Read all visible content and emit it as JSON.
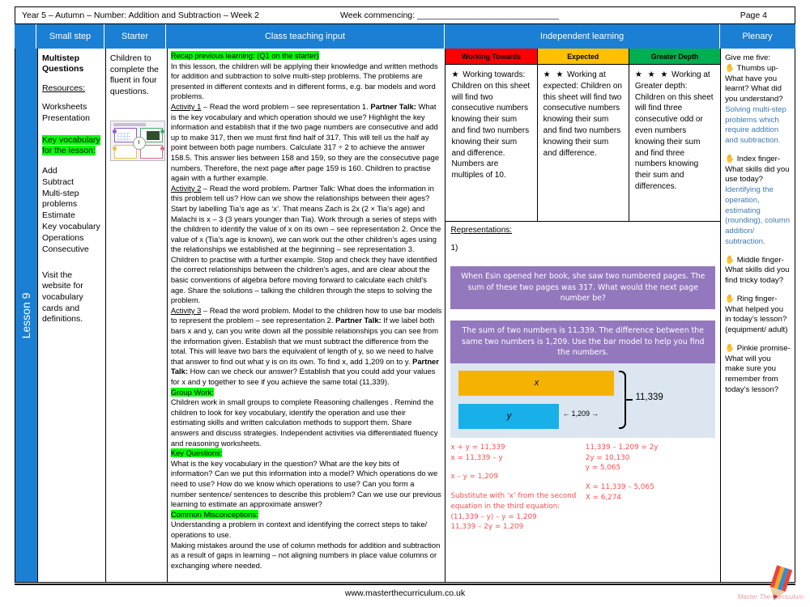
{
  "header": {
    "title": "Year 5 – Autumn – Number: Addition and Subtraction – Week 2",
    "week_commencing_label": "Week commencing: ______________________________",
    "page": "Page 4"
  },
  "columns": {
    "small_step": "Small step",
    "starter": "Starter",
    "class_teaching_input": "Class teaching input",
    "independent_learning": "Independent learning",
    "plenary": "Plenary"
  },
  "lesson_spine": "Lesson 9",
  "small_step": {
    "title": "Multistep Questions",
    "resources_label": "Resources:",
    "resources": [
      "Worksheets",
      "Presentation"
    ],
    "vocab_heading": "Key vocabulary for the lesson:",
    "vocab": [
      "Add",
      "Subtract",
      "Multi-step",
      "problems",
      "Estimate",
      "Key vocabulary",
      "Operations",
      "Consecutive"
    ],
    "visit_note": "Visit the website for vocabulary cards and definitions."
  },
  "starter": {
    "text": "Children to complete the fluent in four questions.",
    "thumbnail_name": "fluent-in-four-worksheet-thumbnail"
  },
  "class_input": {
    "recap_heading": "Recap previous learning: (Q1 on the starter)",
    "intro": "In this lesson, the children will be applying their knowledge and written methods for addition and subtraction to solve multi-step problems. The problems are presented in different contexts and in different forms, e.g. bar models and word problems.",
    "activity1_label": "Activity 1",
    "activity1_lead": " – Read the word problem – see representation 1. ",
    "activity1_talk": "Partner Talk:",
    "activity1_text": " What is the key vocabulary and which operation should we use? Highlight the key information and establish that if the two page numbers are consecutive and add up to make 317, then we must first find half of 317. This will tell us the half ay point between both page numbers. Calculate 317 ÷ 2 to achieve the answer 158.5. This answer lies between 158 and 159, so they are the consecutive page numbers. Therefore, the next page after page 159 is 160. Children to practise again with a further example.",
    "activity2_label": "Activity 2",
    "activity2_text": " – Read the word problem. Partner Talk: What does the information in this problem tell us? How can we show the relationships between their ages?  Start by labelling Tia’s age as ‘x’. That means Zach is 2x (2 × Tia’s age) and Malachi is x – 3 (3 years younger than Tia).  Work through a series of steps with the children to identify the value of x on its own – see representation 2. Once the value of x (Tia’s age is known), we can work out the other children’s ages using the relationships we established at the beginning – see representation 3. Children to practise with a further example. Stop and check they have identified the correct relationships between the children’s ages, and are clear about the basic conventions of algebra before moving forward to calculate each child’s age. Share the solutions – talking the children through the steps to solving the problem.",
    "activity3_label": "Activity 3",
    "activity3_lead": " – Read the word problem. Model to the children how to use bar models to represent the  problem – see representation 2. ",
    "activity3_talk1": "Partner Talk:",
    "activity3_text1": " If we label both bars x and y, can you write down all the possible relationships you can see from the information given. Establish that we must subtract the difference from the total.  This will leave two bars the equivalent of length of y, so we need to halve that answer to find out what y is on its own. To find x, add 1,209 on to y. ",
    "activity3_talk2": "Partner Talk:",
    "activity3_text2": " How can we check our answer? Establish that you could add your values for x and y together to see if you achieve the same total (11,339).",
    "group_work_heading": "Group Work:",
    "group_work_text": "Children work in small groups to complete Reasoning challenges . Remind the children to look for key vocabulary, identify the operation and use their estimating skills and written calculation methods to support them. Share answers and discuss strategies. Independent activities via differentiated fluency and reasoning worksheets.",
    "key_questions_heading": "Key Questions:",
    "key_questions_text": "What is the key vocabulary in the question? What are the key bits of information? Can we put this information into a model? Which operations do we need to use? How do we know which operations to use? Can you form a number sentence/ sentences to describe this problem? Can we use our previous learning to estimate an approximate answer?",
    "misconceptions_heading": "Common Misconceptions:",
    "misconceptions_text1": "Understanding a problem in context and identifying the correct steps to take/ operations to use.",
    "misconceptions_text2": "Making mistakes around the use of column methods for addition and subtraction as a result of gaps in learning – not aligning numbers in place value columns or exchanging where needed."
  },
  "independent": {
    "levels": [
      {
        "header": "Working Towards",
        "color": "#FF0000",
        "stars": "★",
        "lead": "Working towards:",
        "text": "Children on this sheet will find two consecutive numbers knowing their sum and find two numbers knowing their sum and difference. Numbers are multiples of 10."
      },
      {
        "header": "Expected",
        "color": "#FFC000",
        "stars": "★ ★",
        "lead": "Working at expected:",
        "text": "Children on this sheet will find two consecutive numbers knowing their sum and find two numbers knowing their sum and difference."
      },
      {
        "header": "Greater Depth",
        "color": "#00B050",
        "stars": "★ ★ ★",
        "lead": "Working at Greater depth:",
        "text": "Children on this sheet will find three consecutive odd or even numbers knowing their sum and find three numbers knowing their sum and differences."
      }
    ],
    "representations_label": "Representations:",
    "rep_number": "1)",
    "problem1": "When Esin opened her book, she saw two numbered pages. The sum of these two pages was 317. What would the next page number be?",
    "problem2": "The sum of two numbers is 11,339. The difference between the same two numbers is 1,209. Use the bar model to help you find the numbers.",
    "bar_model": {
      "bar_x_label": "x",
      "bar_y_label": "y",
      "total_label": "11,339",
      "difference_label": "1,209",
      "bar_x_color": "#F5B300",
      "bar_y_color": "#18B0E8",
      "background_color": "#DCE6F1"
    },
    "equations_left": [
      "x + y = 11,339",
      "x = 11,339 – y",
      "",
      "x – y = 1,209",
      "",
      "Substitute with ‘x’ from the second",
      "equation in the third equation:",
      "(11,339 – y) – y = 1,209",
      "11,339 – 2y = 1,209"
    ],
    "equations_right": [
      "11,339 – 1,209 = 2y",
      "2y = 10,130",
      "y = 5,065",
      "",
      "X = 11,339 – 5,065",
      "X = 6,274"
    ]
  },
  "plenary": {
    "intro": "Give me five:",
    "items": [
      {
        "q": "Thumbs up- What have you learnt? What did you understand?",
        "a": "Solving multi-step problems which require addition and subtraction."
      },
      {
        "q": "Index finger- What skills did you use today?",
        "a": "Identifying the operation, estimating (rounding), column addition/ subtraction."
      },
      {
        "q": "Middle finger- What skills did you find tricky today?",
        "a": ""
      },
      {
        "q": "Ring finger- What helped you in today’s lesson? (equipment/ adult)",
        "a": ""
      },
      {
        "q": "Pinkie promise- What will you make sure you remember from today’s lesson?",
        "a": ""
      }
    ]
  },
  "footer": {
    "url": "www.masterthecurriculum.co.uk",
    "logo_word": "Master The Curriculum"
  }
}
